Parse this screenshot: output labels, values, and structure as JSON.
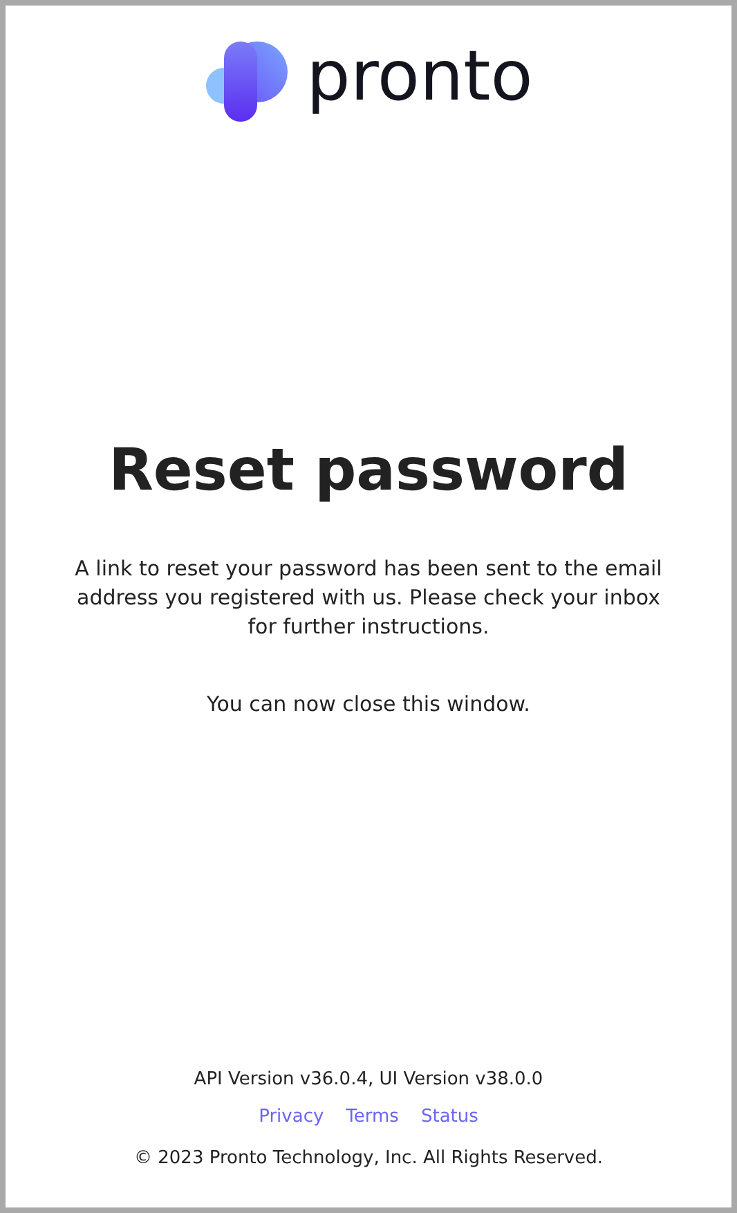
{
  "logo": {
    "wordmark": "pronto"
  },
  "heading": "Reset password",
  "message": "A link to reset your password has been sent to the email address you registered with us. Please check your inbox for further instructions.",
  "note": "You can now close this window.",
  "footer": {
    "version": "API Version v36.0.4, UI Version v38.0.0",
    "links": [
      "Privacy",
      "Terms",
      "Status"
    ],
    "copyright": "© 2023 Pronto Technology, Inc. All Rights Reserved."
  }
}
